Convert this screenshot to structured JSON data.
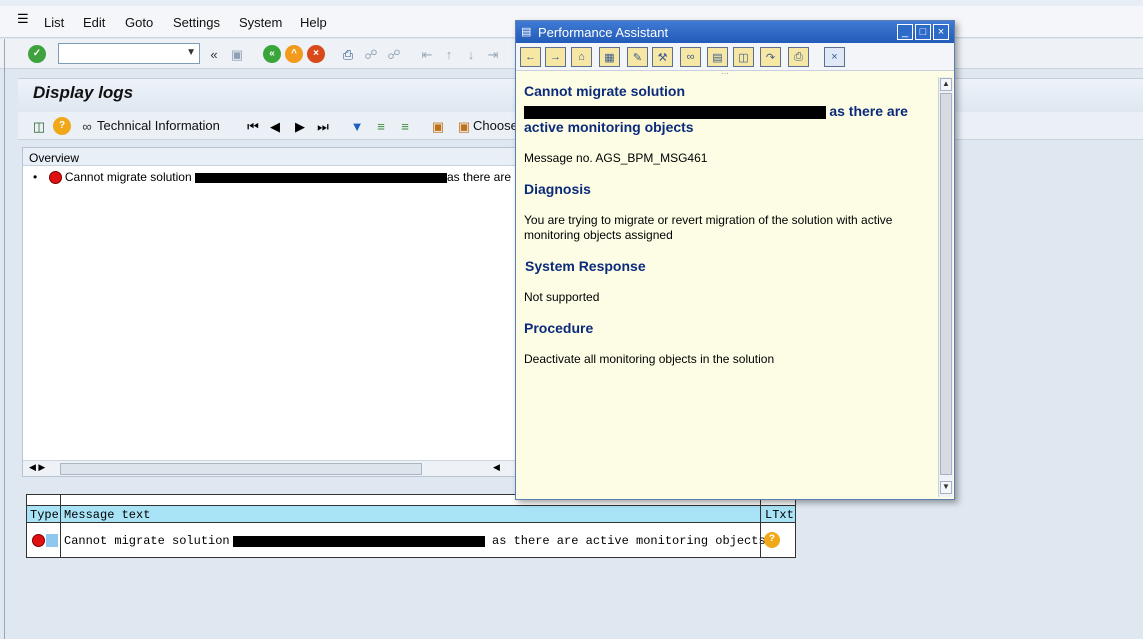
{
  "menu": {
    "items": [
      "List",
      "Edit",
      "Goto",
      "Settings",
      "System",
      "Help"
    ]
  },
  "command_field": {
    "value": "",
    "placeholder": ""
  },
  "page": {
    "title": "Display logs"
  },
  "toolbar2": {
    "technical_information": "Technical Information",
    "choose": "Choose"
  },
  "overview": {
    "header": "Overview",
    "row": {
      "prefix": "Cannot migrate solution",
      "suffix": "as there are"
    }
  },
  "message_table": {
    "col_type": "Type",
    "col_message_text": "Message text",
    "col_ltxt": "LTxt",
    "row": {
      "prefix": "Cannot migrate solution",
      "suffix": "as there are active monitoring objects"
    }
  },
  "popup": {
    "title": "Performance Assistant",
    "heading_line1": "Cannot migrate solution",
    "heading_line2_suffix": "as there are",
    "heading_line3": "active monitoring objects",
    "message_no": "Message no. AGS_BPM_MSG461",
    "diagnosis_heading": "Diagnosis",
    "diagnosis_text_line1": "You are trying to migrate or revert migration of the solution with active",
    "diagnosis_text_line2": "monitoring objects assigned",
    "system_response_heading": "System Response",
    "system_response_text": "Not supported",
    "procedure_heading": "Procedure",
    "procedure_text": "Deactivate all monitoring objects in the solution"
  },
  "colors": {
    "accent": "#0b2a7a",
    "popup_bg": "#fdfde6",
    "table_header": "#a9e3f6",
    "error_red": "#e01010"
  }
}
